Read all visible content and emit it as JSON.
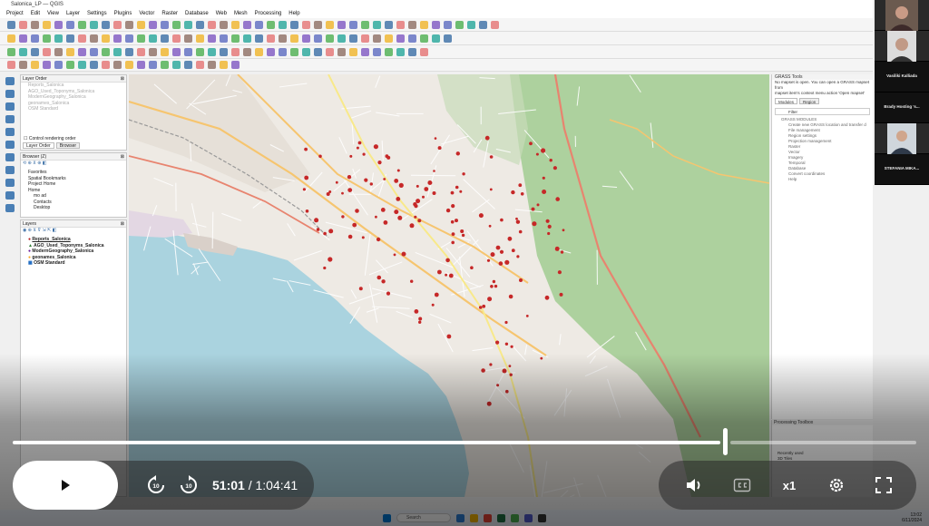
{
  "window": {
    "title": "Salonica_LP — QGIS"
  },
  "menu": [
    "Project",
    "Edit",
    "View",
    "Layer",
    "Settings",
    "Plugins",
    "Vector",
    "Raster",
    "Database",
    "Web",
    "Mesh",
    "Processing",
    "Help"
  ],
  "layer_order": {
    "title": "Layer Order",
    "items": [
      "Reports_Salonica",
      "AGO_Used_Toponyms_Salonica",
      "ModernGeography_Salonica",
      "geonames_Salonica",
      "OSM Standard"
    ],
    "control_label": "Control rendering order",
    "tabs": [
      "Layer Order",
      "Browser"
    ]
  },
  "browser": {
    "title": "Browser (Z)",
    "items": [
      "Favorites",
      "Spatial Bookmarks",
      "Project Home",
      "Home",
      "mo ad",
      "Contacts",
      "Desktop"
    ]
  },
  "layers": {
    "title": "Layers",
    "items": [
      "Reports_Salonica",
      "AGO_Used_Toponyms_Salonica",
      "ModernGeography_Salonica",
      "geonames_Salonica",
      "OSM Standard"
    ]
  },
  "grass": {
    "title": "GRASS Tools",
    "msg1": "No mapset is open. You can open a GRASS mapset from",
    "msg2": "mapset item's context menu action 'Open mapset'",
    "tabs": [
      "Modules",
      "Region"
    ],
    "filter": "Filter",
    "items": [
      "GRASS MODULES",
      "Create new GRASS location and transfer d",
      "File management",
      "Region settings",
      "Projection management",
      "Raster",
      "Vector",
      "Imagery",
      "Temporal",
      "Database",
      "Convert coordinates",
      "Help"
    ]
  },
  "processing": {
    "title": "Processing Toolbox",
    "items": [
      "Recently used",
      "3D Tiles"
    ]
  },
  "participants": [
    {
      "name": "Vasiliki Kalliada"
    },
    {
      "name": "Brady Hosting 's..."
    },
    {
      "name": "STEFANIA MIKA..."
    }
  ],
  "player": {
    "current": "51:01",
    "total": "/ 1:04:41",
    "speed": "x1",
    "progress": 0.788,
    "skip_back": "10",
    "skip_fwd": "10"
  },
  "taskbar": {
    "search": "Search",
    "time": "13:02",
    "date": "6/11/2024"
  },
  "colors": {
    "accent": "#ffffff",
    "point": "#c62828",
    "water": "#aad3df",
    "forest": "#add19e"
  }
}
